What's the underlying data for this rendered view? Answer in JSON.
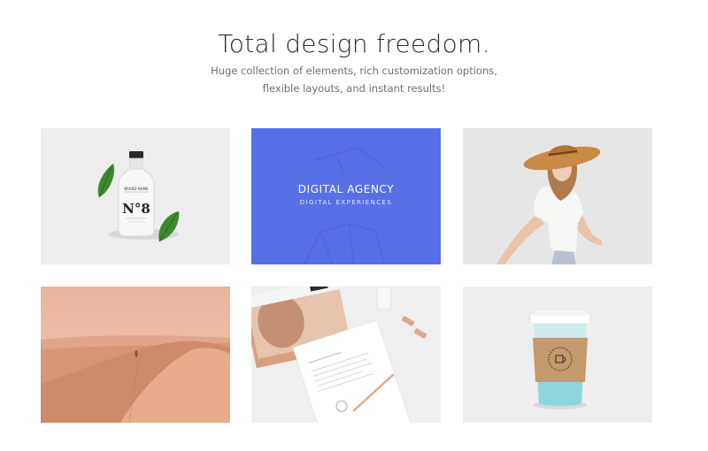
{
  "header": {
    "title": "Total design freedom.",
    "subtitle_line1": "Huge collection of elements, rich customization options,",
    "subtitle_line2": "flexible layouts, and instant results!"
  },
  "gallery": {
    "tiles": [
      {
        "name": "bottle-mockup",
        "bottle_label": "N°8",
        "bottle_brand": "BRAND NAME"
      },
      {
        "name": "digital-agency",
        "title": "DIGITAL AGENCY",
        "subtitle": "DIGITAL EXPERIENCES",
        "color": "#5770e8"
      },
      {
        "name": "woman-in-hat"
      },
      {
        "name": "desert-dunes"
      },
      {
        "name": "stationery-mockup"
      },
      {
        "name": "coffee-cup-mockup"
      }
    ]
  }
}
